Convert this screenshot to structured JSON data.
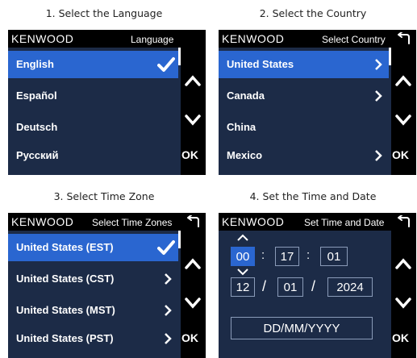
{
  "captions": [
    "1. Select the Language",
    "2. Select the Country",
    "3. Select Time Zone",
    "4. Set the Time and Date"
  ],
  "brand": "KENWOOD",
  "ok_label": "OK",
  "panels": {
    "language": {
      "title": "Language",
      "items": [
        "English",
        "Español",
        "Deutsch",
        "Русский"
      ]
    },
    "country": {
      "title": "Select Country",
      "items": [
        "United States",
        "Canada",
        "China",
        "Mexico"
      ]
    },
    "timezone": {
      "title": "Select Time Zones",
      "items": [
        "United States (EST)",
        "United States (CST)",
        "United States (MST)",
        "United States (PST)"
      ]
    },
    "datetime": {
      "title": "Set Time and Date",
      "hour": "00",
      "minute": "17",
      "second": "01",
      "time_sep": ":",
      "day": "12",
      "month": "01",
      "year": "2024",
      "date_sep": "/",
      "format": "DD/MM/YYYY"
    }
  },
  "colors": {
    "screen_bg": "#1c2b47",
    "selected": "#2a66d0",
    "frame": "#000000"
  },
  "icons": {
    "check": "check-icon",
    "arrow": "chevron-right-icon",
    "up": "chevron-up-icon",
    "down": "chevron-down-icon",
    "back": "back-arrow-icon"
  }
}
